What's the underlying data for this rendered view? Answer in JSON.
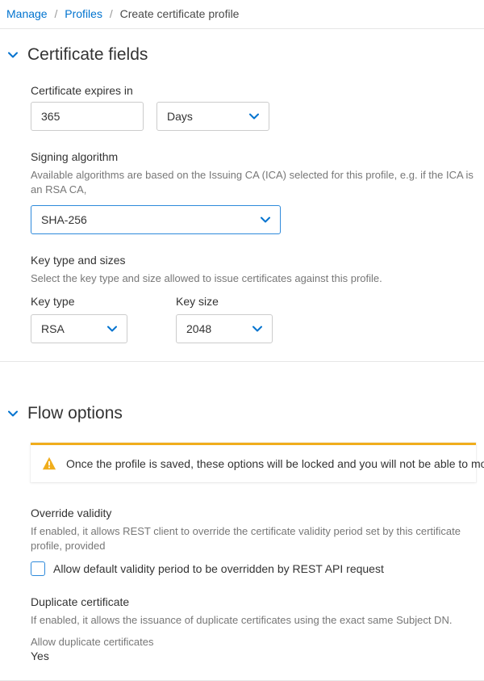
{
  "breadcrumb": {
    "manage": "Manage",
    "profiles": "Profiles",
    "current": "Create certificate profile"
  },
  "sections": {
    "cert_fields": {
      "title": "Certificate fields",
      "expires": {
        "label": "Certificate expires in",
        "value": "365",
        "unit": "Days"
      },
      "signing": {
        "label": "Signing algorithm",
        "help": "Available algorithms are based on the Issuing CA (ICA) selected for this profile, e.g. if the ICA is an RSA CA,",
        "value": "SHA-256"
      },
      "keytype": {
        "group_label": "Key type and sizes",
        "help": "Select the key type and size allowed to issue certificates against this profile.",
        "key_type_label": "Key type",
        "key_type_value": "RSA",
        "key_size_label": "Key size",
        "key_size_value": "2048"
      }
    },
    "flow": {
      "title": "Flow options",
      "warning": "Once the profile is saved, these options will be locked and you will not be able to modify them",
      "override": {
        "label": "Override validity",
        "help": "If enabled, it allows REST client to override the certificate validity period set by this certificate profile, provided",
        "checkbox_label": "Allow default validity period to be overridden by REST API request"
      },
      "duplicate": {
        "label": "Duplicate certificate",
        "help": "If enabled, it allows the issuance of duplicate certificates using the exact same Subject DN.",
        "readonly_label": "Allow duplicate certificates",
        "readonly_value": "Yes"
      }
    }
  }
}
